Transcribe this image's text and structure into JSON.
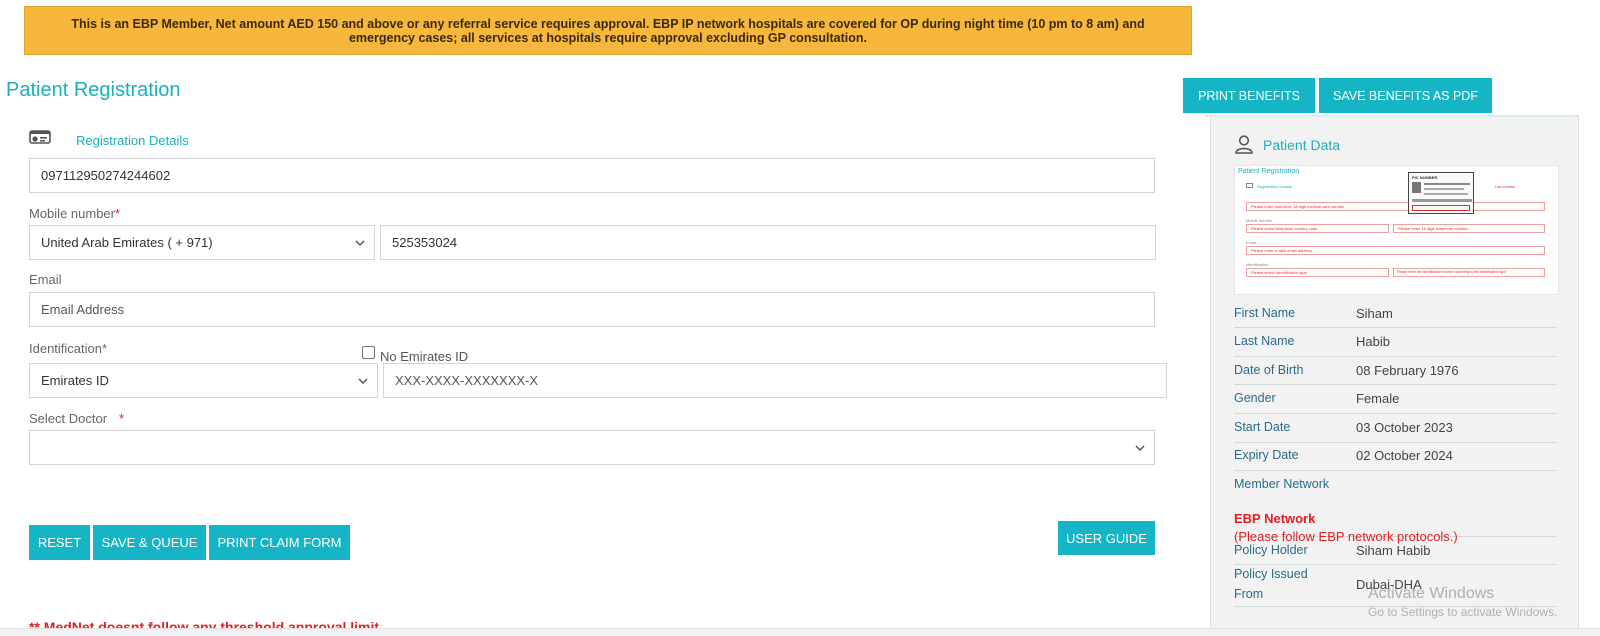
{
  "banner": {
    "text": "This is an EBP Member, Net amount AED 150 and above or any referral service requires approval. EBP IP network hospitals are covered for OP during night time (10 pm to 8 am) and emergency cases; all services at hospitals require approval excluding GP consultation."
  },
  "page": {
    "title": "Patient Registration"
  },
  "registration": {
    "section_label": "Registration Details",
    "card_number": "097112950274244602",
    "mobile_label": "Mobile number",
    "mobile_required": "*",
    "country_code": "United Arab Emirates ( + 971)",
    "mobile_value": "525353024",
    "email_label": "Email",
    "email_placeholder": "Email Address",
    "identification_label": "Identification*",
    "no_emirates_id_label": "No Emirates ID",
    "id_type": "Emirates ID",
    "id_placeholder": "XXX-XXXX-XXXXXXX-X",
    "doctor_label": "Select Doctor",
    "doctor_required": "*",
    "doctor_value": ""
  },
  "buttons": {
    "reset": "RESET",
    "save_queue": "SAVE & QUEUE",
    "print_claim": "PRINT CLAIM FORM",
    "user_guide": "USER GUIDE",
    "print_benefits": "PRINT BENEFITS",
    "save_benefits_pdf": "SAVE BENEFITS AS PDF"
  },
  "footer_note": "** MedNet doesnt follow any threshold approval limit",
  "patient_data": {
    "title": "Patient Data",
    "thumbnail": {
      "title": "Patient Registration",
      "section": "Registration Details",
      "err_card": "Please enter members' 18 digit medical card number",
      "mobile_label": "Mobile number",
      "err_country": "Please select telephone country code",
      "err_phone": "Please enter 10 digit telephone number",
      "email_label": "Email",
      "err_email": "Please enter a valid email address",
      "id_label": "Identification",
      "err_id_type": "Please select identification type",
      "err_id_number": "Please enter the identification number according to the identification type",
      "card_title": "PIC NUMBER",
      "card_note": "Card number"
    },
    "fields": [
      {
        "key": "First Name",
        "value": "Siham"
      },
      {
        "key": "Last Name",
        "value": "Habib"
      },
      {
        "key": "Date of Birth",
        "value": "08 February 1976"
      },
      {
        "key": "Gender",
        "value": "Female"
      },
      {
        "key": "Start Date",
        "value": "03 October 2023"
      },
      {
        "key": "Expiry Date",
        "value": "02 October 2024"
      }
    ],
    "member_network_label": "Member Network",
    "network_name": "EBP Network",
    "network_note": "(Please follow EBP network protocols.)",
    "policy_holder_label": "Policy Holder",
    "policy_holder_value": "Siham Habib",
    "policy_issued_label_1": "Policy Issued",
    "policy_issued_label_2": "From",
    "policy_issued_value": "Dubai-DHA"
  },
  "watermark": {
    "line1": "Activate Windows",
    "line2": "Go to Settings to activate Windows."
  },
  "colors": {
    "accent": "#15b5c5",
    "banner": "#f6b73c",
    "required": "#e02020"
  }
}
